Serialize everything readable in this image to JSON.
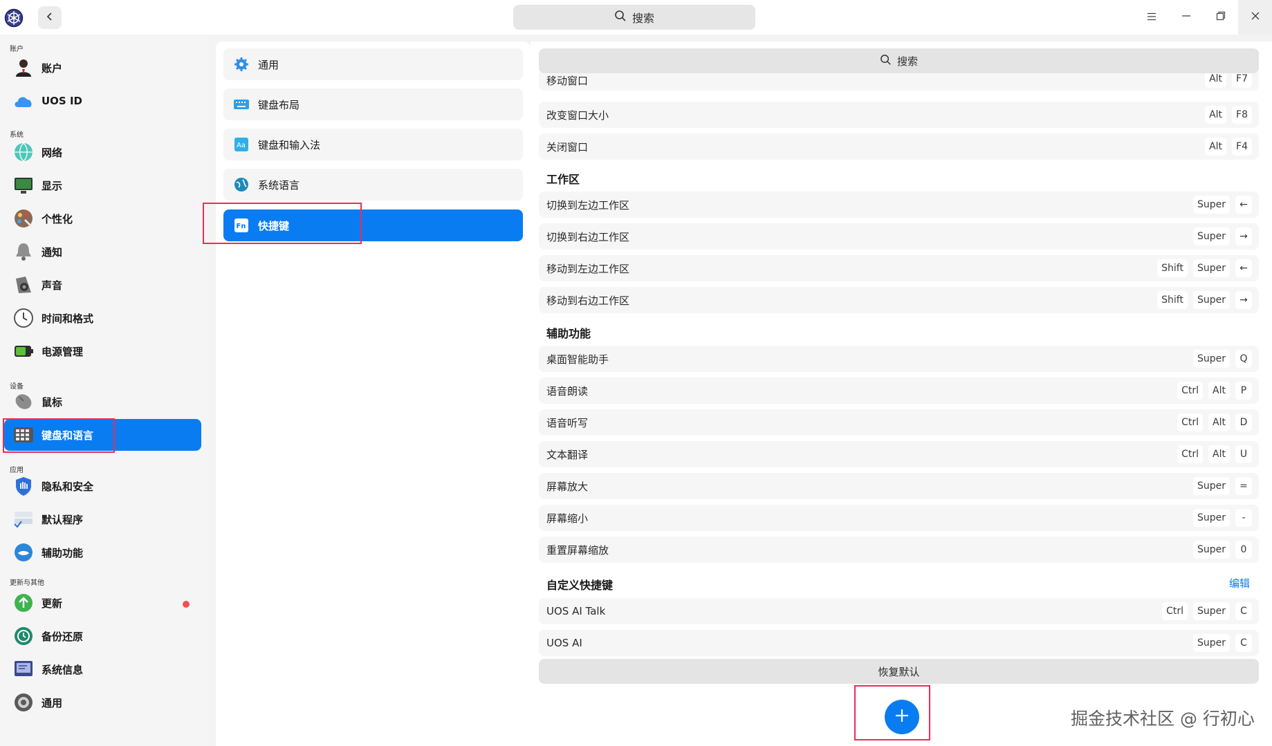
{
  "titlebar": {
    "search_placeholder": "搜索"
  },
  "sidebar": {
    "groups": {
      "account": "账户",
      "system": "系统",
      "device": "设备",
      "apps": "应用",
      "update_other": "更新与其他"
    },
    "items": [
      {
        "label": "账户",
        "icon": "user-icon"
      },
      {
        "label": "UOS ID",
        "icon": "cloud-icon"
      },
      {
        "label": "网络",
        "icon": "globe-network-icon"
      },
      {
        "label": "显示",
        "icon": "monitor-icon"
      },
      {
        "label": "个性化",
        "icon": "palette-icon"
      },
      {
        "label": "通知",
        "icon": "bell-icon"
      },
      {
        "label": "声音",
        "icon": "speaker-icon"
      },
      {
        "label": "时间和格式",
        "icon": "clock-icon"
      },
      {
        "label": "电源管理",
        "icon": "battery-icon"
      },
      {
        "label": "鼠标",
        "icon": "mouse-icon"
      },
      {
        "label": "键盘和语言",
        "icon": "keyboard-icon"
      },
      {
        "label": "隐私和安全",
        "icon": "shield-icon"
      },
      {
        "label": "默认程序",
        "icon": "default-apps-icon"
      },
      {
        "label": "辅助功能",
        "icon": "accessibility-icon"
      },
      {
        "label": "更新",
        "icon": "update-arrow-icon"
      },
      {
        "label": "备份还原",
        "icon": "backup-icon"
      },
      {
        "label": "系统信息",
        "icon": "system-info-icon"
      },
      {
        "label": "通用",
        "icon": "general-settings-icon"
      }
    ]
  },
  "middle": {
    "items": [
      {
        "label": "通用",
        "icon": "gear-icon"
      },
      {
        "label": "键盘布局",
        "icon": "keyboard-layout-icon"
      },
      {
        "label": "键盘和输入法",
        "icon": "input-method-icon"
      },
      {
        "label": "系统语言",
        "icon": "language-globe-icon"
      },
      {
        "label": "快捷键",
        "icon": "fn-key-icon"
      }
    ]
  },
  "content": {
    "search_placeholder": "搜索",
    "window_rows": [
      {
        "name": "移动窗口",
        "keys": [
          "Alt",
          "F7"
        ]
      },
      {
        "name": "改变窗口大小",
        "keys": [
          "Alt",
          "F8"
        ]
      },
      {
        "name": "关闭窗口",
        "keys": [
          "Alt",
          "F4"
        ]
      }
    ],
    "workspace": {
      "title": "工作区",
      "rows": [
        {
          "name": "切换到左边工作区",
          "keys": [
            "Super",
            "←"
          ]
        },
        {
          "name": "切换到右边工作区",
          "keys": [
            "Super",
            "→"
          ]
        },
        {
          "name": "移动到左边工作区",
          "keys": [
            "Shift",
            "Super",
            "←"
          ]
        },
        {
          "name": "移动到右边工作区",
          "keys": [
            "Shift",
            "Super",
            "→"
          ]
        }
      ]
    },
    "assistive": {
      "title": "辅助功能",
      "rows": [
        {
          "name": "桌面智能助手",
          "keys": [
            "Super",
            "Q"
          ]
        },
        {
          "name": "语音朗读",
          "keys": [
            "Ctrl",
            "Alt",
            "P"
          ]
        },
        {
          "name": "语音听写",
          "keys": [
            "Ctrl",
            "Alt",
            "D"
          ]
        },
        {
          "name": "文本翻译",
          "keys": [
            "Ctrl",
            "Alt",
            "U"
          ]
        },
        {
          "name": "屏幕放大",
          "keys": [
            "Super",
            "="
          ]
        },
        {
          "name": "屏幕缩小",
          "keys": [
            "Super",
            "-"
          ]
        },
        {
          "name": "重置屏幕缩放",
          "keys": [
            "Super",
            "0"
          ]
        }
      ]
    },
    "custom": {
      "title": "自定义快捷键",
      "edit_label": "编辑",
      "rows": [
        {
          "name": "UOS AI Talk",
          "keys": [
            "Ctrl",
            "Super",
            "C"
          ]
        },
        {
          "name": "UOS AI",
          "keys": [
            "Super",
            "C"
          ]
        }
      ]
    },
    "restore_label": "恢复默认",
    "add_icon": "plus-icon"
  },
  "watermark": "掘金技术社区 @ 行初心",
  "colors": {
    "accent": "#0a7cf2",
    "highlight_box": "#f02a55",
    "notification_dot": "#f25050"
  }
}
